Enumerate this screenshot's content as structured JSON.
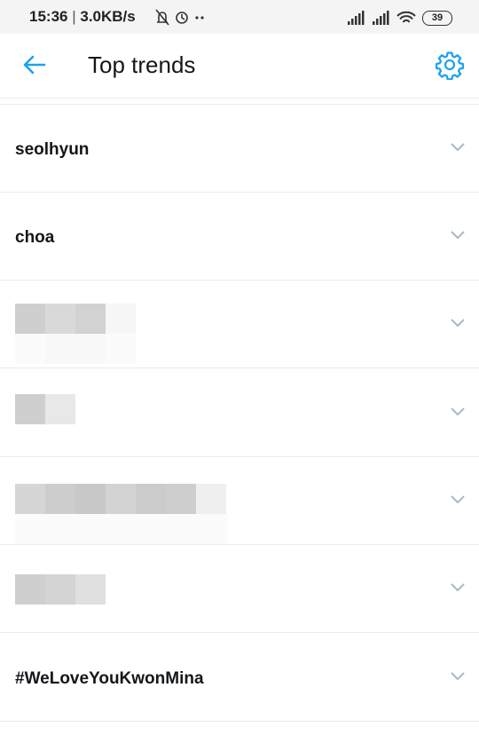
{
  "status_bar": {
    "time": "15:36",
    "speed": "3.0KB/s",
    "battery": "39",
    "icons": [
      "mute-bell-icon",
      "alarm-icon",
      "more-dots-icon",
      "signal-icon",
      "signal-icon",
      "wifi-icon",
      "battery-icon"
    ]
  },
  "header": {
    "title": "Top trends",
    "back_icon": "arrow-left-icon",
    "settings_icon": "gear-icon"
  },
  "trends": [
    {
      "label": "seolhyun",
      "redacted": false
    },
    {
      "label": "choa",
      "redacted": false
    },
    {
      "label": "",
      "redacted": true
    },
    {
      "label": "",
      "redacted": true
    },
    {
      "label": "",
      "redacted": true
    },
    {
      "label": "",
      "redacted": true
    },
    {
      "label": "#WeLoveYouKwonMina",
      "redacted": false
    }
  ],
  "colors": {
    "accent": "#1da1f2",
    "text": "#14171a",
    "chevron": "#aab8c2",
    "divider": "#e6ecf0"
  }
}
